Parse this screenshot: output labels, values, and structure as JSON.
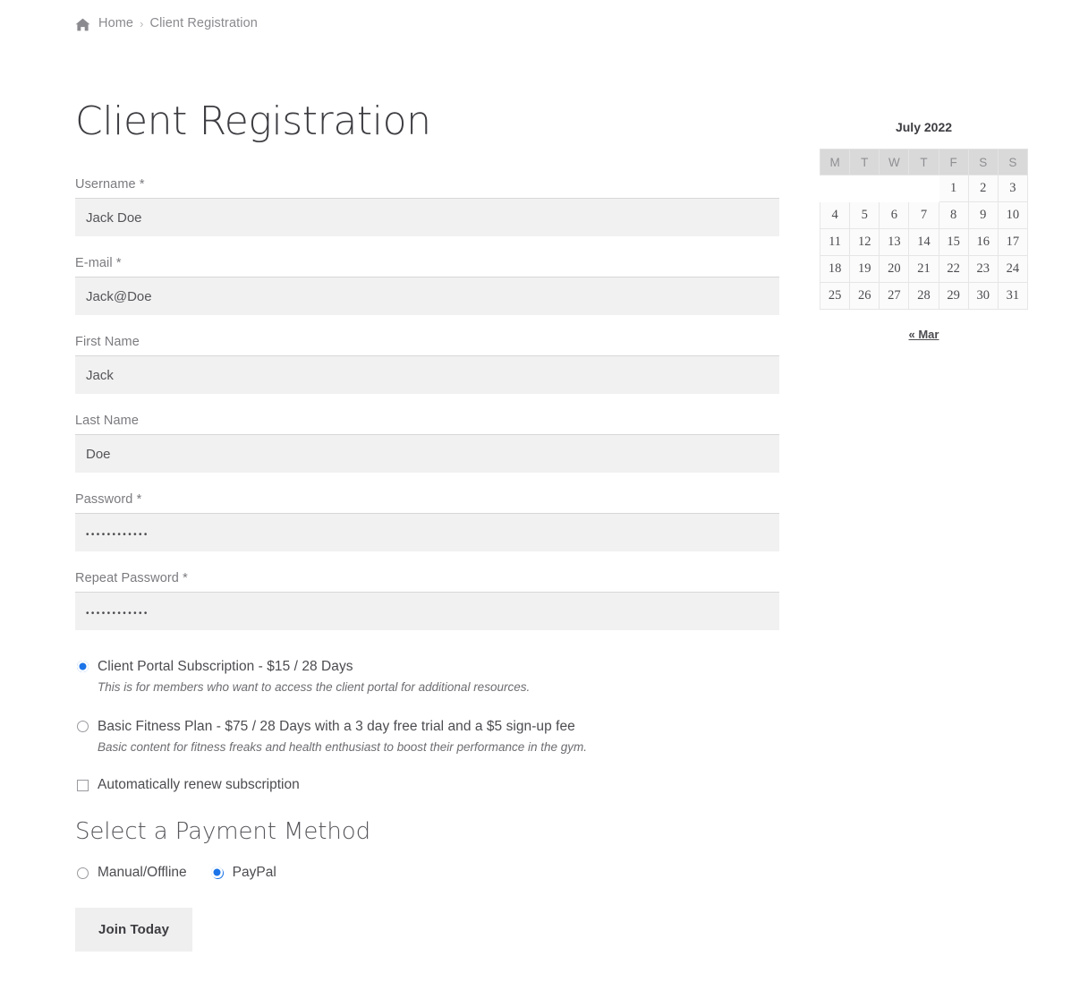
{
  "breadcrumb": {
    "home_icon": "home-icon",
    "home": "Home",
    "separator": "›",
    "current": "Client Registration"
  },
  "page": {
    "title": "Client Registration"
  },
  "form": {
    "fields": [
      {
        "label": "Username *",
        "value": "Jack Doe",
        "placeholder": "",
        "type": "text"
      },
      {
        "label": "E-mail *",
        "value": "Jack@Doe",
        "placeholder": "",
        "type": "text"
      },
      {
        "label": "First Name",
        "value": "Jack",
        "placeholder": "",
        "type": "text"
      },
      {
        "label": "Last Name",
        "value": "Doe",
        "placeholder": "",
        "type": "text"
      },
      {
        "label": "Password *",
        "value": "••••••••••••",
        "placeholder": "",
        "type": "password"
      },
      {
        "label": "Repeat Password *",
        "value": "••••••••••••",
        "placeholder": "",
        "type": "password"
      }
    ],
    "levels": [
      {
        "label": "Client Portal Subscription - $15 / 28 Days",
        "description": "This is for members who want to access the client portal for additional resources.",
        "selected": true
      },
      {
        "label": "Basic Fitness Plan - $75 / 28 Days with a 3 day free trial and a $5 sign-up fee",
        "description": "Basic content for fitness freaks and health enthusiast to boost their performance in the gym.",
        "selected": false
      }
    ],
    "auto_renew": {
      "label": "Automatically renew subscription",
      "checked": false
    },
    "payment": {
      "title": "Select a Payment Method",
      "options": [
        {
          "label": "Manual/Offline",
          "selected": false
        },
        {
          "label": "PayPal",
          "selected": true
        }
      ]
    },
    "submit_label": "Join Today"
  },
  "calendar": {
    "caption": "July 2022",
    "weekday_headers": [
      "M",
      "T",
      "W",
      "T",
      "F",
      "S",
      "S"
    ],
    "weeks": [
      [
        "",
        "",
        "",
        "",
        "1",
        "2",
        "3"
      ],
      [
        "4",
        "5",
        "6",
        "7",
        "8",
        "9",
        "10"
      ],
      [
        "11",
        "12",
        "13",
        "14",
        "15",
        "16",
        "17"
      ],
      [
        "18",
        "19",
        "20",
        "21",
        "22",
        "23",
        "24"
      ],
      [
        "25",
        "26",
        "27",
        "28",
        "29",
        "30",
        "31"
      ]
    ],
    "prev_link": "« Mar"
  },
  "colors": {
    "accent": "#1a73e8",
    "input_bg": "#f1f1f1",
    "button_bg": "#efefef",
    "calendar_header_bg": "#d9d9d9"
  }
}
